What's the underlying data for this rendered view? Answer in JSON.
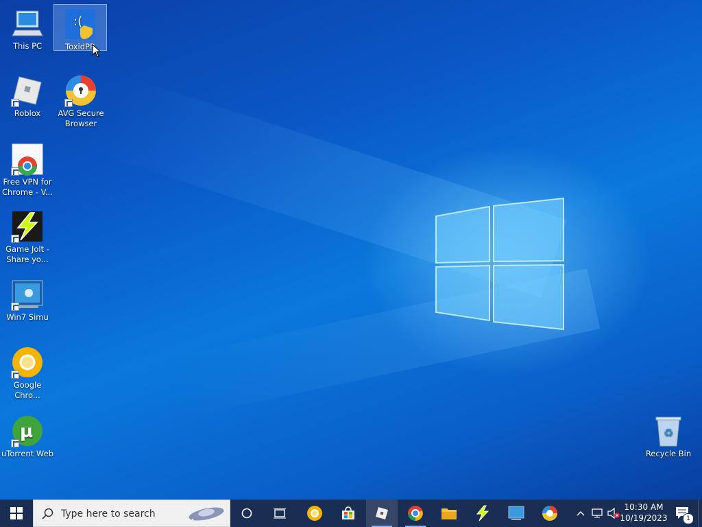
{
  "desktop": {
    "icons": [
      {
        "name": "This PC"
      },
      {
        "name": "ToxidPR"
      },
      {
        "name": "Roblox"
      },
      {
        "name": "AVG Secure Browser"
      },
      {
        "name": "Free VPN for Chrome - V..."
      },
      {
        "name": "Game Jolt - Share yo..."
      },
      {
        "name": "Win7 Simu"
      },
      {
        "name": "Google Chro..."
      },
      {
        "name": "uTorrent Web"
      },
      {
        "name": "Recycle Bin"
      }
    ]
  },
  "taskbar": {
    "search_placeholder": "Type here to search",
    "time": "10:30 AM",
    "date": "10/19/2023",
    "notification_count": "1"
  },
  "colors": {
    "taskbar": "#1a2d52",
    "accent": "#0a78dc"
  }
}
